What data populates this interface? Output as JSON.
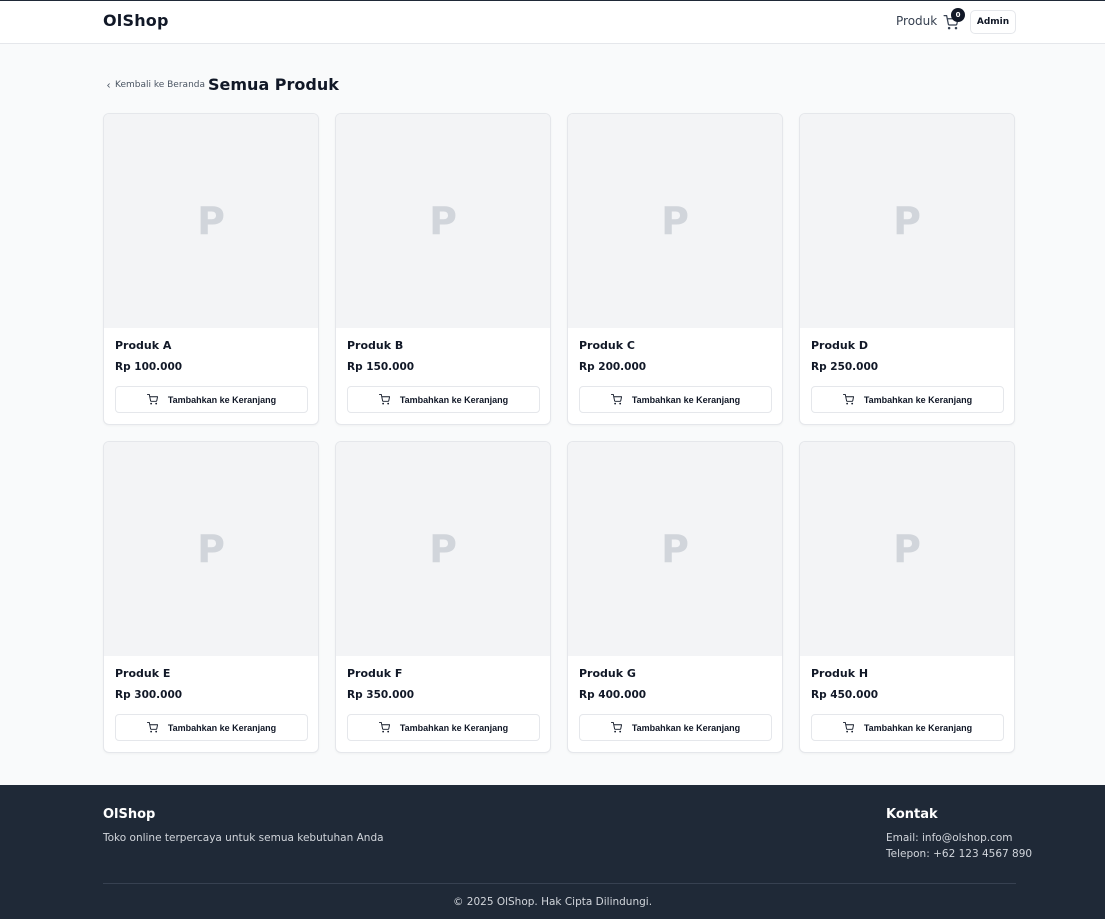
{
  "header": {
    "logo": "OlShop",
    "nav_products": "Produk",
    "cart_count": "0",
    "admin_label": "Admin"
  },
  "breadcrumb": {
    "back_label": "Kembali ke Beranda"
  },
  "page_title": "Semua Produk",
  "products": [
    {
      "placeholder": "P",
      "name": "Produk A",
      "price": "Rp 100.000",
      "button": "Tambahkan ke Keranjang"
    },
    {
      "placeholder": "P",
      "name": "Produk B",
      "price": "Rp 150.000",
      "button": "Tambahkan ke Keranjang"
    },
    {
      "placeholder": "P",
      "name": "Produk C",
      "price": "Rp 200.000",
      "button": "Tambahkan ke Keranjang"
    },
    {
      "placeholder": "P",
      "name": "Produk D",
      "price": "Rp 250.000",
      "button": "Tambahkan ke Keranjang"
    },
    {
      "placeholder": "P",
      "name": "Produk E",
      "price": "Rp 300.000",
      "button": "Tambahkan ke Keranjang"
    },
    {
      "placeholder": "P",
      "name": "Produk F",
      "price": "Rp 350.000",
      "button": "Tambahkan ke Keranjang"
    },
    {
      "placeholder": "P",
      "name": "Produk G",
      "price": "Rp 400.000",
      "button": "Tambahkan ke Keranjang"
    },
    {
      "placeholder": "P",
      "name": "Produk H",
      "price": "Rp 450.000",
      "button": "Tambahkan ke Keranjang"
    }
  ],
  "footer": {
    "brand": "OlShop",
    "tagline": "Toko online terpercaya untuk semua kebutuhan Anda",
    "contact_title": "Kontak",
    "email": "Email: info@olshop.com",
    "phone": "Telepon: +62 123 4567 890",
    "copyright": "© 2025 OlShop. Hak Cipta Dilindungi."
  },
  "icons": {
    "cart": "cart-icon",
    "back": "chevron-left-icon"
  },
  "colors": {
    "footer_bg": "#1f2937",
    "page_bg": "#f9fafb",
    "image_placeholder_bg": "#f3f4f6",
    "badge_bg": "#111827"
  }
}
